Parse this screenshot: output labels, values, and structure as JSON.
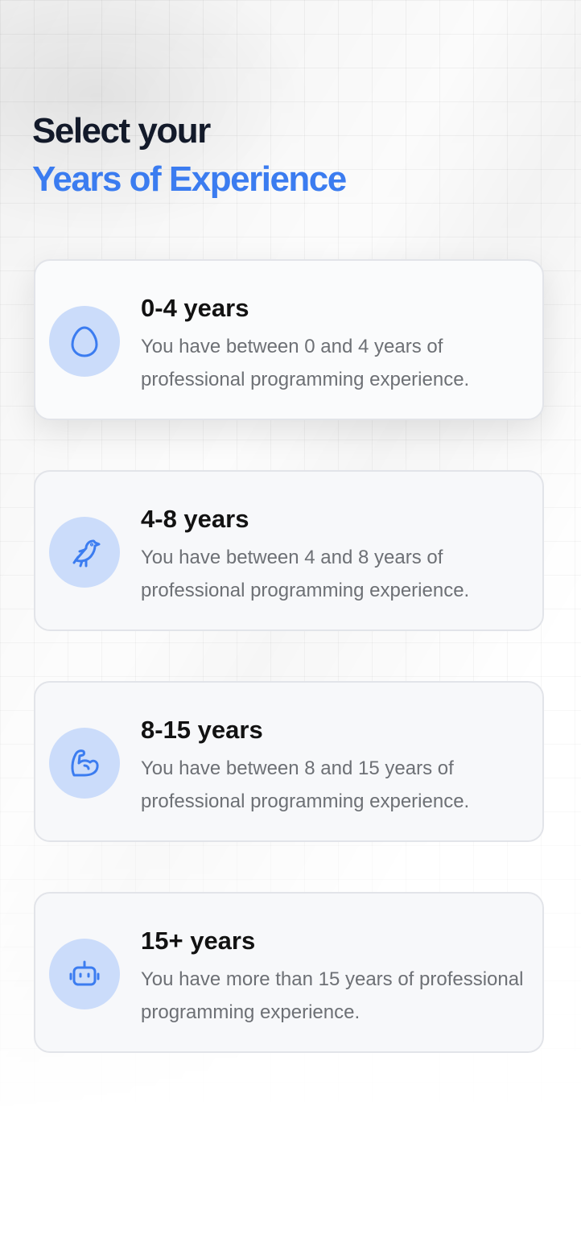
{
  "header": {
    "title_line1": "Select your",
    "title_line2": "Years of Experience"
  },
  "options": [
    {
      "label": "0-4 years",
      "description": "You have between 0 and 4 years of professional programming experience.",
      "icon": "egg-icon"
    },
    {
      "label": "4-8 years",
      "description": "You have between 4 and 8 years of professional programming experience.",
      "icon": "bird-icon"
    },
    {
      "label": "8-15 years",
      "description": "You have between 8 and 15 years of professional programming experience.",
      "icon": "muscle-arm-icon"
    },
    {
      "label": "15+ years",
      "description": "You have more than 15 years of professional programming experience.",
      "icon": "robot-icon"
    }
  ],
  "colors": {
    "accent": "#3b7cf0",
    "icon_background": "#cbdcfa",
    "title_dark": "#131a2a",
    "description_text": "#6d7075"
  }
}
